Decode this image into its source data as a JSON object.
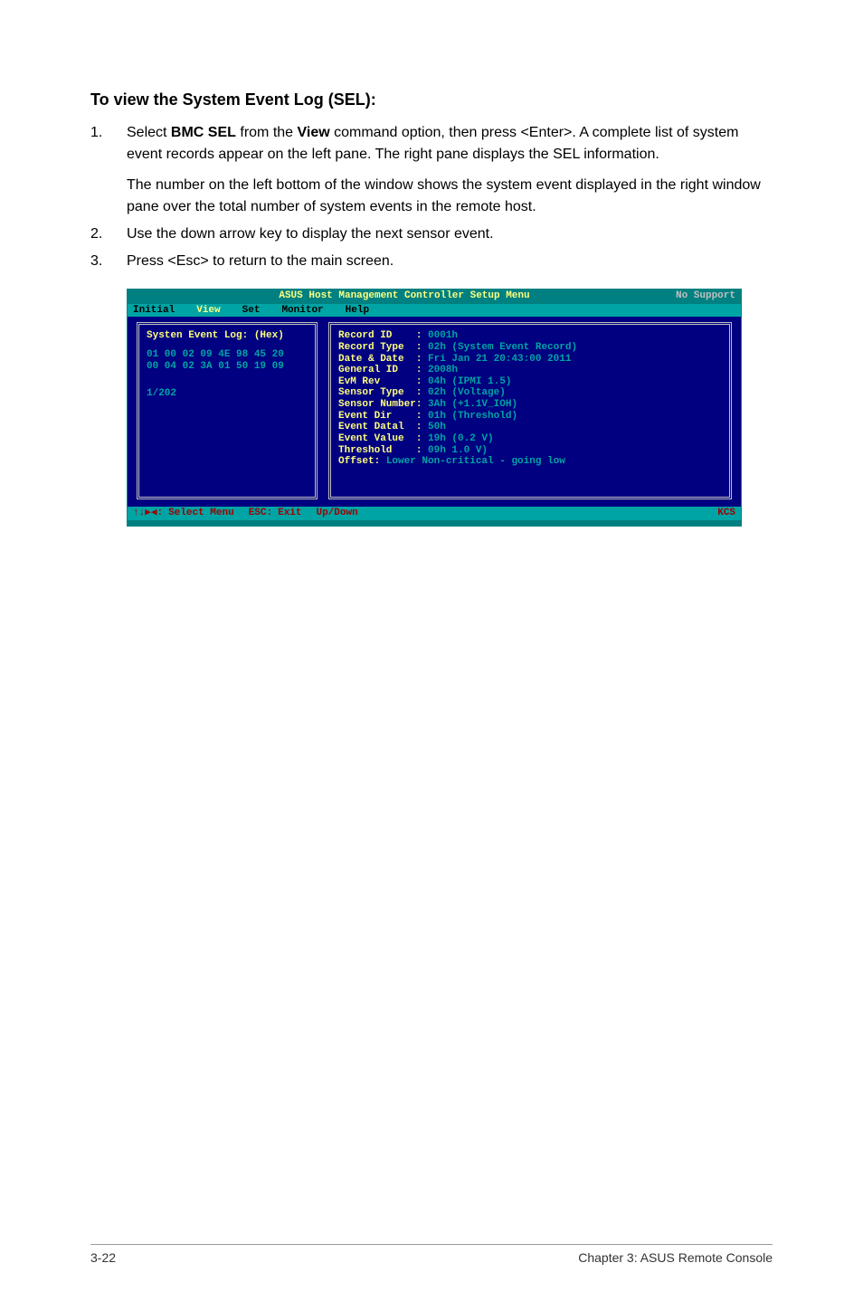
{
  "heading": "To view the System Event Log (SEL):",
  "steps": [
    {
      "num": "1.",
      "parts": [
        {
          "before": "Select ",
          "bold1": "BMC SEL",
          "mid": " from the ",
          "bold2": "View",
          "after": " command option, then press <Enter>. A complete list of system event records appear on the left pane. The right pane displays the SEL information."
        },
        {
          "plain": "The number on the left bottom of the window shows the system event displayed in the right window pane over the total number of system events in the remote host."
        }
      ]
    },
    {
      "num": "2.",
      "parts": [
        {
          "plain": "Use the down arrow key to display the next sensor event."
        }
      ]
    },
    {
      "num": "3.",
      "parts": [
        {
          "plain": "Press <Esc> to return to the main screen."
        }
      ]
    }
  ],
  "terminal": {
    "titlebar": {
      "left": " ",
      "mid": "ASUS Host Management Controller Setup Menu",
      "right": "No Support"
    },
    "menubar": [
      "Initial",
      "View",
      "Set",
      "Monitor",
      "Help"
    ],
    "menu_selected_index": 1,
    "left_pane": {
      "head": "Systen Event Log: (Hex)",
      "hex1": "01 00 02 09 4E 98 45 20",
      "hex2": "00 04 02 3A 01 50 19 09",
      "count": "1/202"
    },
    "right_pane": [
      {
        "label": "Record ID    :",
        "value": " 0001h"
      },
      {
        "label": "Record Type  :",
        "value": " 02h (System Event Record)"
      },
      {
        "label": "Date & Date  :",
        "value": " Fri Jan 21 20:43:00 2011"
      },
      {
        "label": "General ID   :",
        "value": " 2008h"
      },
      {
        "label": "EvM Rev      :",
        "value": " 04h (IPMI 1.5)"
      },
      {
        "label": "Sensor Type  :",
        "value": " 02h (Voltage)"
      },
      {
        "label": "Sensor Number:",
        "value": " 3Ah (+1.1V_IOH)"
      },
      {
        "label": "Event Dir    :",
        "value": " 01h (Threshold)"
      },
      {
        "label": "Event Datal  :",
        "value": " 50h"
      },
      {
        "label": "Event Value  :",
        "value": " 19h (0.2 V)"
      },
      {
        "label": "Threshold    :",
        "value": " 09h 1.0 V)"
      },
      {
        "label": "Offset:",
        "value": " Lower Non-critical - going low"
      }
    ],
    "statusbar": {
      "nav": "↑↓▶◀:",
      "nav_label": "Select Menu",
      "esc": "ESC:",
      "esc_label": "Exit",
      "updown": "Up/Down",
      "right": "KCS"
    }
  },
  "footer": {
    "left": "3-22",
    "right": "Chapter 3: ASUS Remote Console"
  }
}
